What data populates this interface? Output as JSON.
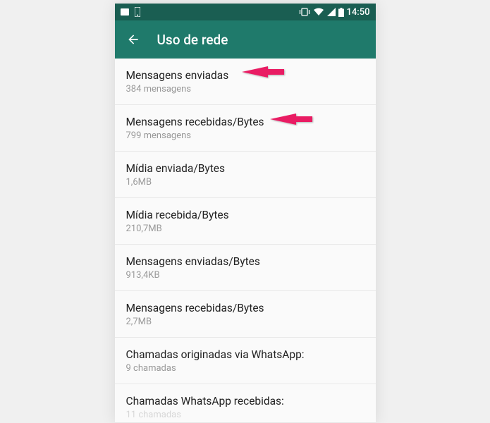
{
  "status_bar": {
    "time": "14:50"
  },
  "app_bar": {
    "title": "Uso de rede"
  },
  "items": [
    {
      "title": "Mensagens enviadas",
      "subtitle": "384 mensagens"
    },
    {
      "title": "Mensagens recebidas/Bytes",
      "subtitle": "799 mensagens"
    },
    {
      "title": "Mídia enviada/Bytes",
      "subtitle": "1,6MB"
    },
    {
      "title": "Mídia recebida/Bytes",
      "subtitle": "210,7MB"
    },
    {
      "title": "Mensagens enviadas/Bytes",
      "subtitle": "913,4KB"
    },
    {
      "title": "Mensagens recebidas/Bytes",
      "subtitle": "2,7MB"
    },
    {
      "title": "Chamadas originadas via WhatsApp:",
      "subtitle": "9 chamadas"
    },
    {
      "title": "Chamadas WhatsApp recebidas:",
      "subtitle": "11 chamadas"
    }
  ]
}
